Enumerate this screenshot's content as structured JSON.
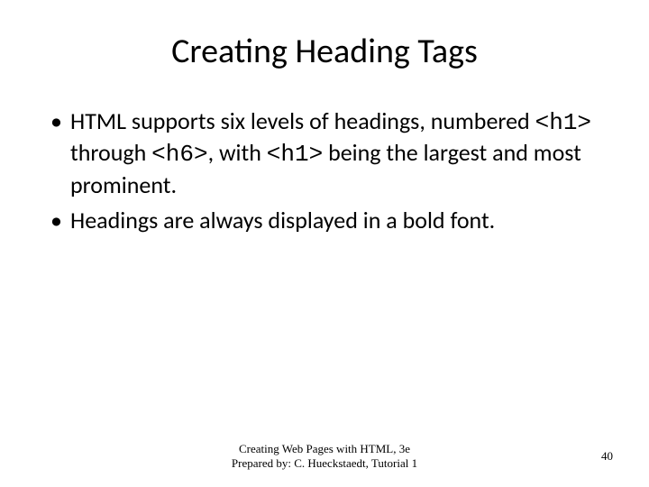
{
  "title": "Creating Heading Tags",
  "bullets": [
    {
      "pre": "HTML supports six levels of headings, numbered ",
      "code1": "<h1>",
      "mid1": " through ",
      "code2": "<h6>",
      "mid2": ", with ",
      "code3": "<h1>",
      "post": " being the largest and most prominent."
    },
    {
      "text": "Headings are always displayed in a bold font."
    }
  ],
  "footer": {
    "line1": "Creating Web Pages with HTML, 3e",
    "line2": "Prepared by: C. Hueckstaedt, Tutorial 1",
    "page": "40"
  }
}
